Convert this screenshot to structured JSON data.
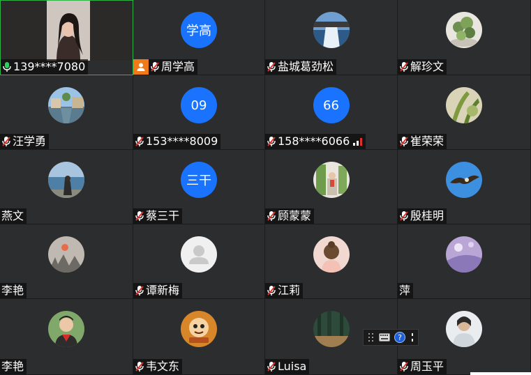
{
  "participants": [
    {
      "name": "139****7080",
      "mic": "on"
    },
    {
      "name": "周学高",
      "mic": "off",
      "avatar_text": "学高",
      "host": true
    },
    {
      "name": "盐城葛劲松",
      "mic": "off"
    },
    {
      "name": "解珍文",
      "mic": "off"
    },
    {
      "name": "汪学勇",
      "mic": "off"
    },
    {
      "name": "153****8009",
      "mic": "off",
      "avatar_text": "09"
    },
    {
      "name": "158****6066",
      "mic": "off",
      "avatar_text": "66",
      "signal": true
    },
    {
      "name": "崔荣荣",
      "mic": "off"
    },
    {
      "name": "燕文",
      "mic": "none"
    },
    {
      "name": "蔡三干",
      "mic": "off",
      "avatar_text": "三干"
    },
    {
      "name": "顾蒙蒙",
      "mic": "off"
    },
    {
      "name": "殷桂明",
      "mic": "off"
    },
    {
      "name": "李艳",
      "mic": "none"
    },
    {
      "name": "谭新梅",
      "mic": "off"
    },
    {
      "name": "江莉",
      "mic": "off"
    },
    {
      "name": "萍",
      "mic": "none"
    },
    {
      "name": "李艳",
      "mic": "none"
    },
    {
      "name": "韦文东",
      "mic": "off"
    },
    {
      "name": "Luisa",
      "mic": "off"
    },
    {
      "name": "周玉平",
      "mic": "off"
    }
  ],
  "colors": {
    "avatar_blue": "#1a73ff",
    "host_orange": "#f07a1a",
    "active_border": "#2fb24a",
    "mic_off_red": "#e0302b"
  }
}
